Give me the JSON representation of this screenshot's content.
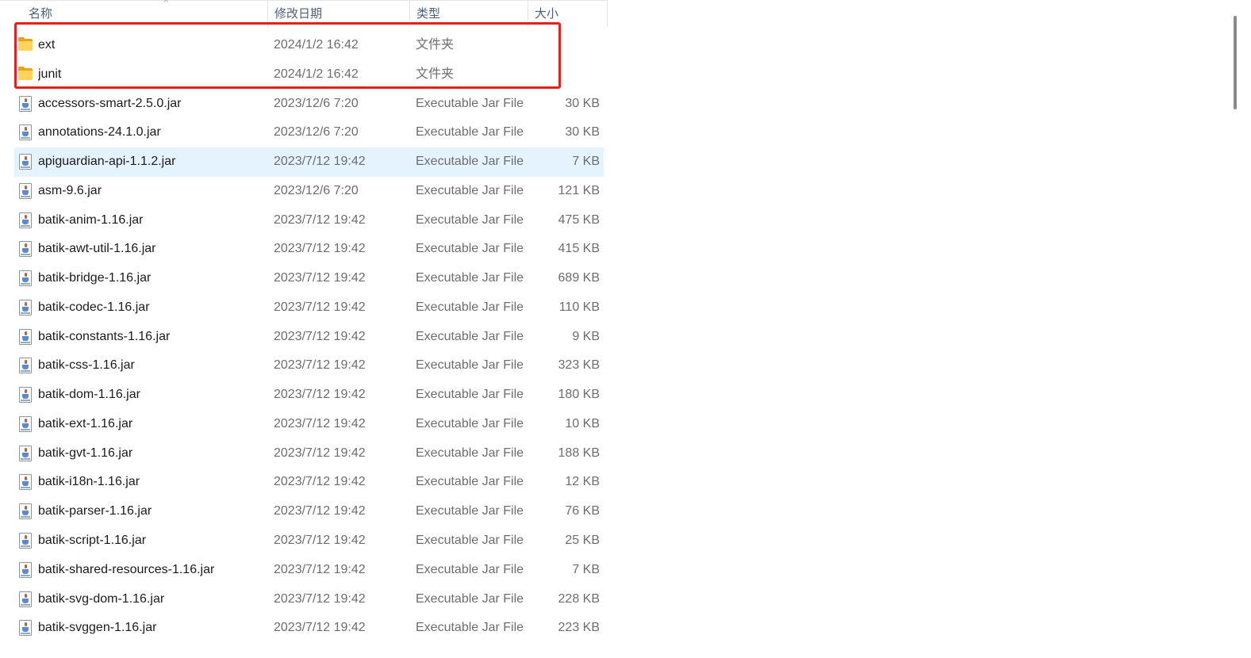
{
  "columns": {
    "name": "名称",
    "date": "修改日期",
    "type": "类型",
    "size": "大小"
  },
  "sort_indicator": "^",
  "files": [
    {
      "name": "ext",
      "date": "2024/1/2 16:42",
      "type": "文件夹",
      "size": "",
      "icon": "folder-icon"
    },
    {
      "name": "junit",
      "date": "2024/1/2 16:42",
      "type": "文件夹",
      "size": "",
      "icon": "folder-icon"
    },
    {
      "name": "accessors-smart-2.5.0.jar",
      "date": "2023/12/6 7:20",
      "type": "Executable Jar File",
      "size": "30 KB",
      "icon": "jar-file-icon"
    },
    {
      "name": "annotations-24.1.0.jar",
      "date": "2023/12/6 7:20",
      "type": "Executable Jar File",
      "size": "30 KB",
      "icon": "jar-file-icon"
    },
    {
      "name": "apiguardian-api-1.1.2.jar",
      "date": "2023/7/12 19:42",
      "type": "Executable Jar File",
      "size": "7 KB",
      "icon": "jar-file-icon",
      "selected": true
    },
    {
      "name": "asm-9.6.jar",
      "date": "2023/12/6 7:20",
      "type": "Executable Jar File",
      "size": "121 KB",
      "icon": "jar-file-icon"
    },
    {
      "name": "batik-anim-1.16.jar",
      "date": "2023/7/12 19:42",
      "type": "Executable Jar File",
      "size": "475 KB",
      "icon": "jar-file-icon"
    },
    {
      "name": "batik-awt-util-1.16.jar",
      "date": "2023/7/12 19:42",
      "type": "Executable Jar File",
      "size": "415 KB",
      "icon": "jar-file-icon"
    },
    {
      "name": "batik-bridge-1.16.jar",
      "date": "2023/7/12 19:42",
      "type": "Executable Jar File",
      "size": "689 KB",
      "icon": "jar-file-icon"
    },
    {
      "name": "batik-codec-1.16.jar",
      "date": "2023/7/12 19:42",
      "type": "Executable Jar File",
      "size": "110 KB",
      "icon": "jar-file-icon"
    },
    {
      "name": "batik-constants-1.16.jar",
      "date": "2023/7/12 19:42",
      "type": "Executable Jar File",
      "size": "9 KB",
      "icon": "jar-file-icon"
    },
    {
      "name": "batik-css-1.16.jar",
      "date": "2023/7/12 19:42",
      "type": "Executable Jar File",
      "size": "323 KB",
      "icon": "jar-file-icon"
    },
    {
      "name": "batik-dom-1.16.jar",
      "date": "2023/7/12 19:42",
      "type": "Executable Jar File",
      "size": "180 KB",
      "icon": "jar-file-icon"
    },
    {
      "name": "batik-ext-1.16.jar",
      "date": "2023/7/12 19:42",
      "type": "Executable Jar File",
      "size": "10 KB",
      "icon": "jar-file-icon"
    },
    {
      "name": "batik-gvt-1.16.jar",
      "date": "2023/7/12 19:42",
      "type": "Executable Jar File",
      "size": "188 KB",
      "icon": "jar-file-icon"
    },
    {
      "name": "batik-i18n-1.16.jar",
      "date": "2023/7/12 19:42",
      "type": "Executable Jar File",
      "size": "12 KB",
      "icon": "jar-file-icon"
    },
    {
      "name": "batik-parser-1.16.jar",
      "date": "2023/7/12 19:42",
      "type": "Executable Jar File",
      "size": "76 KB",
      "icon": "jar-file-icon"
    },
    {
      "name": "batik-script-1.16.jar",
      "date": "2023/7/12 19:42",
      "type": "Executable Jar File",
      "size": "25 KB",
      "icon": "jar-file-icon"
    },
    {
      "name": "batik-shared-resources-1.16.jar",
      "date": "2023/7/12 19:42",
      "type": "Executable Jar File",
      "size": "7 KB",
      "icon": "jar-file-icon"
    },
    {
      "name": "batik-svg-dom-1.16.jar",
      "date": "2023/7/12 19:42",
      "type": "Executable Jar File",
      "size": "228 KB",
      "icon": "jar-file-icon"
    },
    {
      "name": "batik-svggen-1.16.jar",
      "date": "2023/7/12 19:42",
      "type": "Executable Jar File",
      "size": "223 KB",
      "icon": "jar-file-icon"
    }
  ],
  "colors": {
    "selection_bg": "#e5f3ff",
    "highlight_border": "#e3201b",
    "header_text": "#4c607a",
    "folder": "#ffd35c"
  }
}
